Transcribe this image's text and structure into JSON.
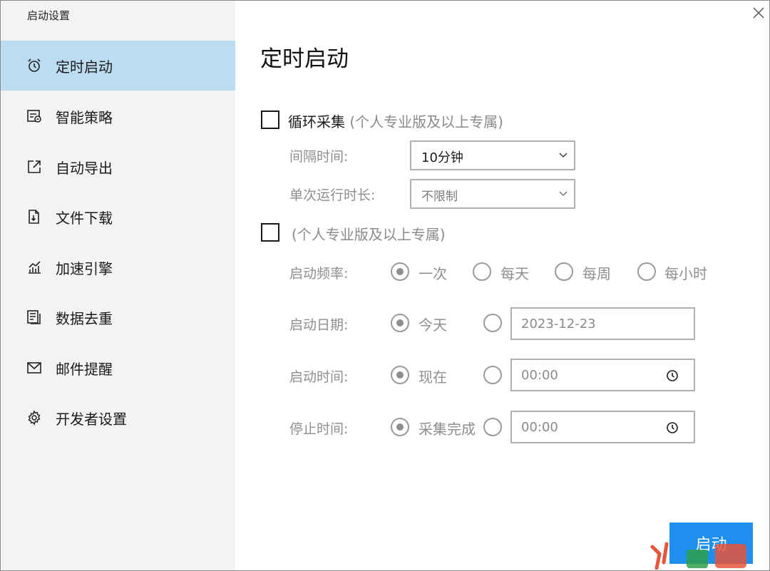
{
  "window": {
    "title": "启动设置"
  },
  "sidebar": {
    "items": [
      {
        "label": "定时启动",
        "icon": "alarm-clock-icon",
        "active": true
      },
      {
        "label": "智能策略",
        "icon": "strategy-icon"
      },
      {
        "label": "自动导出",
        "icon": "export-icon"
      },
      {
        "label": "文件下载",
        "icon": "file-download-icon"
      },
      {
        "label": "加速引擎",
        "icon": "chart-up-icon"
      },
      {
        "label": "数据去重",
        "icon": "dedupe-icon"
      },
      {
        "label": "邮件提醒",
        "icon": "mail-icon"
      },
      {
        "label": "开发者设置",
        "icon": "gear-icon"
      }
    ]
  },
  "main": {
    "title": "定时启动",
    "loop": {
      "label": "循环采集",
      "note": "(个人专业版及以上专属)",
      "checked": false,
      "interval_label": "间隔时间:",
      "interval_value": "10分钟",
      "duration_label": "单次运行时长:",
      "duration_value": "不限制"
    },
    "schedule": {
      "note": "(个人专业版及以上专属)",
      "checked": false,
      "frequency_label": "启动频率:",
      "frequency_options": [
        "一次",
        "每天",
        "每周",
        "每小时"
      ],
      "date_label": "启动日期:",
      "date_today": "今天",
      "date_value": "2023-12-23",
      "time_label": "启动时间:",
      "time_now": "现在",
      "time_value": "00:00",
      "stop_label": "停止时间:",
      "stop_done": "采集完成",
      "stop_value": "00:00"
    },
    "start_button": "启动"
  },
  "colors": {
    "accent": "#1e8fef",
    "active_nav": "#bcdcf2",
    "sidebar_bg": "#f3f3f3"
  }
}
